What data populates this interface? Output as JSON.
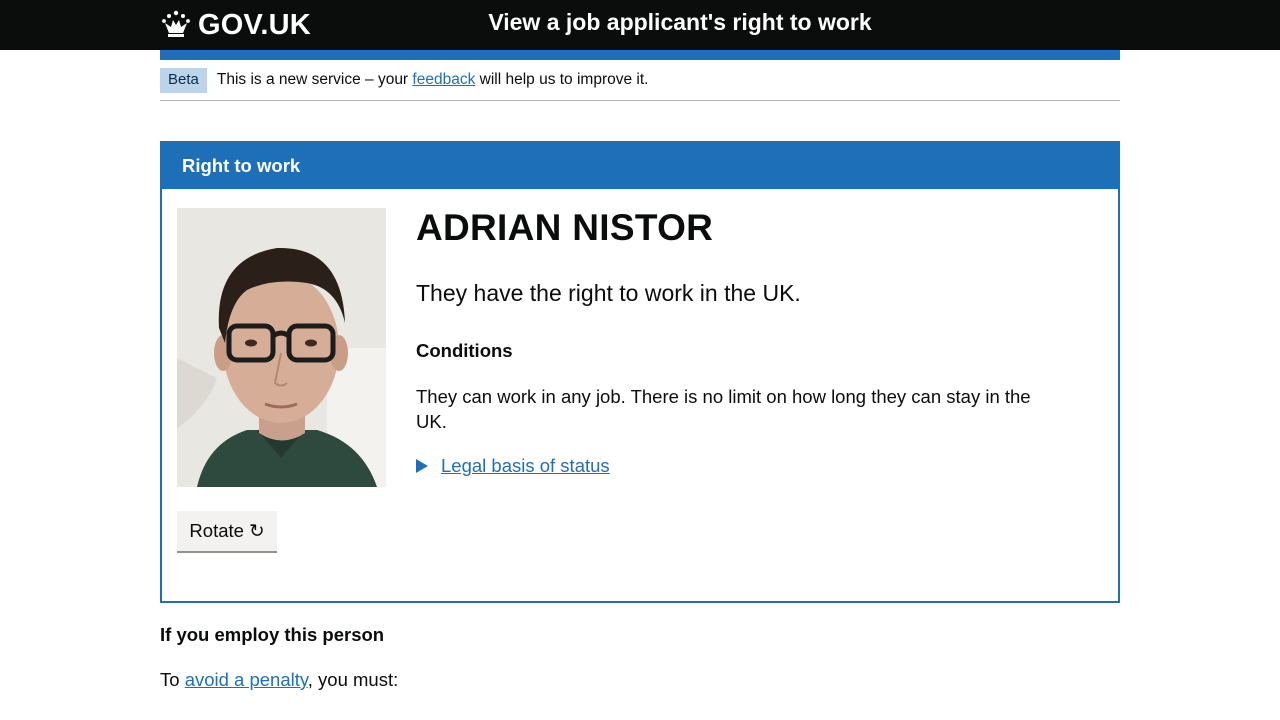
{
  "header": {
    "logo_text": "GOV.UK",
    "service_name": "View a job applicant's right to work"
  },
  "phase_banner": {
    "tag": "Beta",
    "text_before": "This is a new service – your ",
    "link_text": "feedback",
    "text_after": " will help us to improve it."
  },
  "panel": {
    "title": "Right to work",
    "person_name": "ADRIAN NISTOR",
    "status_text": "They have the right to work in the UK.",
    "conditions_heading": "Conditions",
    "conditions_text": "They can work in any job. There is no limit on how long they can stay in the UK.",
    "details_summary": "Legal basis of status",
    "rotate_label": "Rotate ↻"
  },
  "employ": {
    "heading": "If you employ this person",
    "text_before": "To ",
    "link_text": "avoid a penalty",
    "text_after": ", you must:"
  },
  "colors": {
    "header_bg": "#0b0c0c",
    "brand_blue": "#1d70b8",
    "phase_tag_bg": "#bbd4ea",
    "button_bg": "#f3f2f1"
  },
  "icons": {
    "logo": "crown-icon",
    "details": "triangle-right-icon",
    "rotate": "rotate-arrow-icon"
  }
}
